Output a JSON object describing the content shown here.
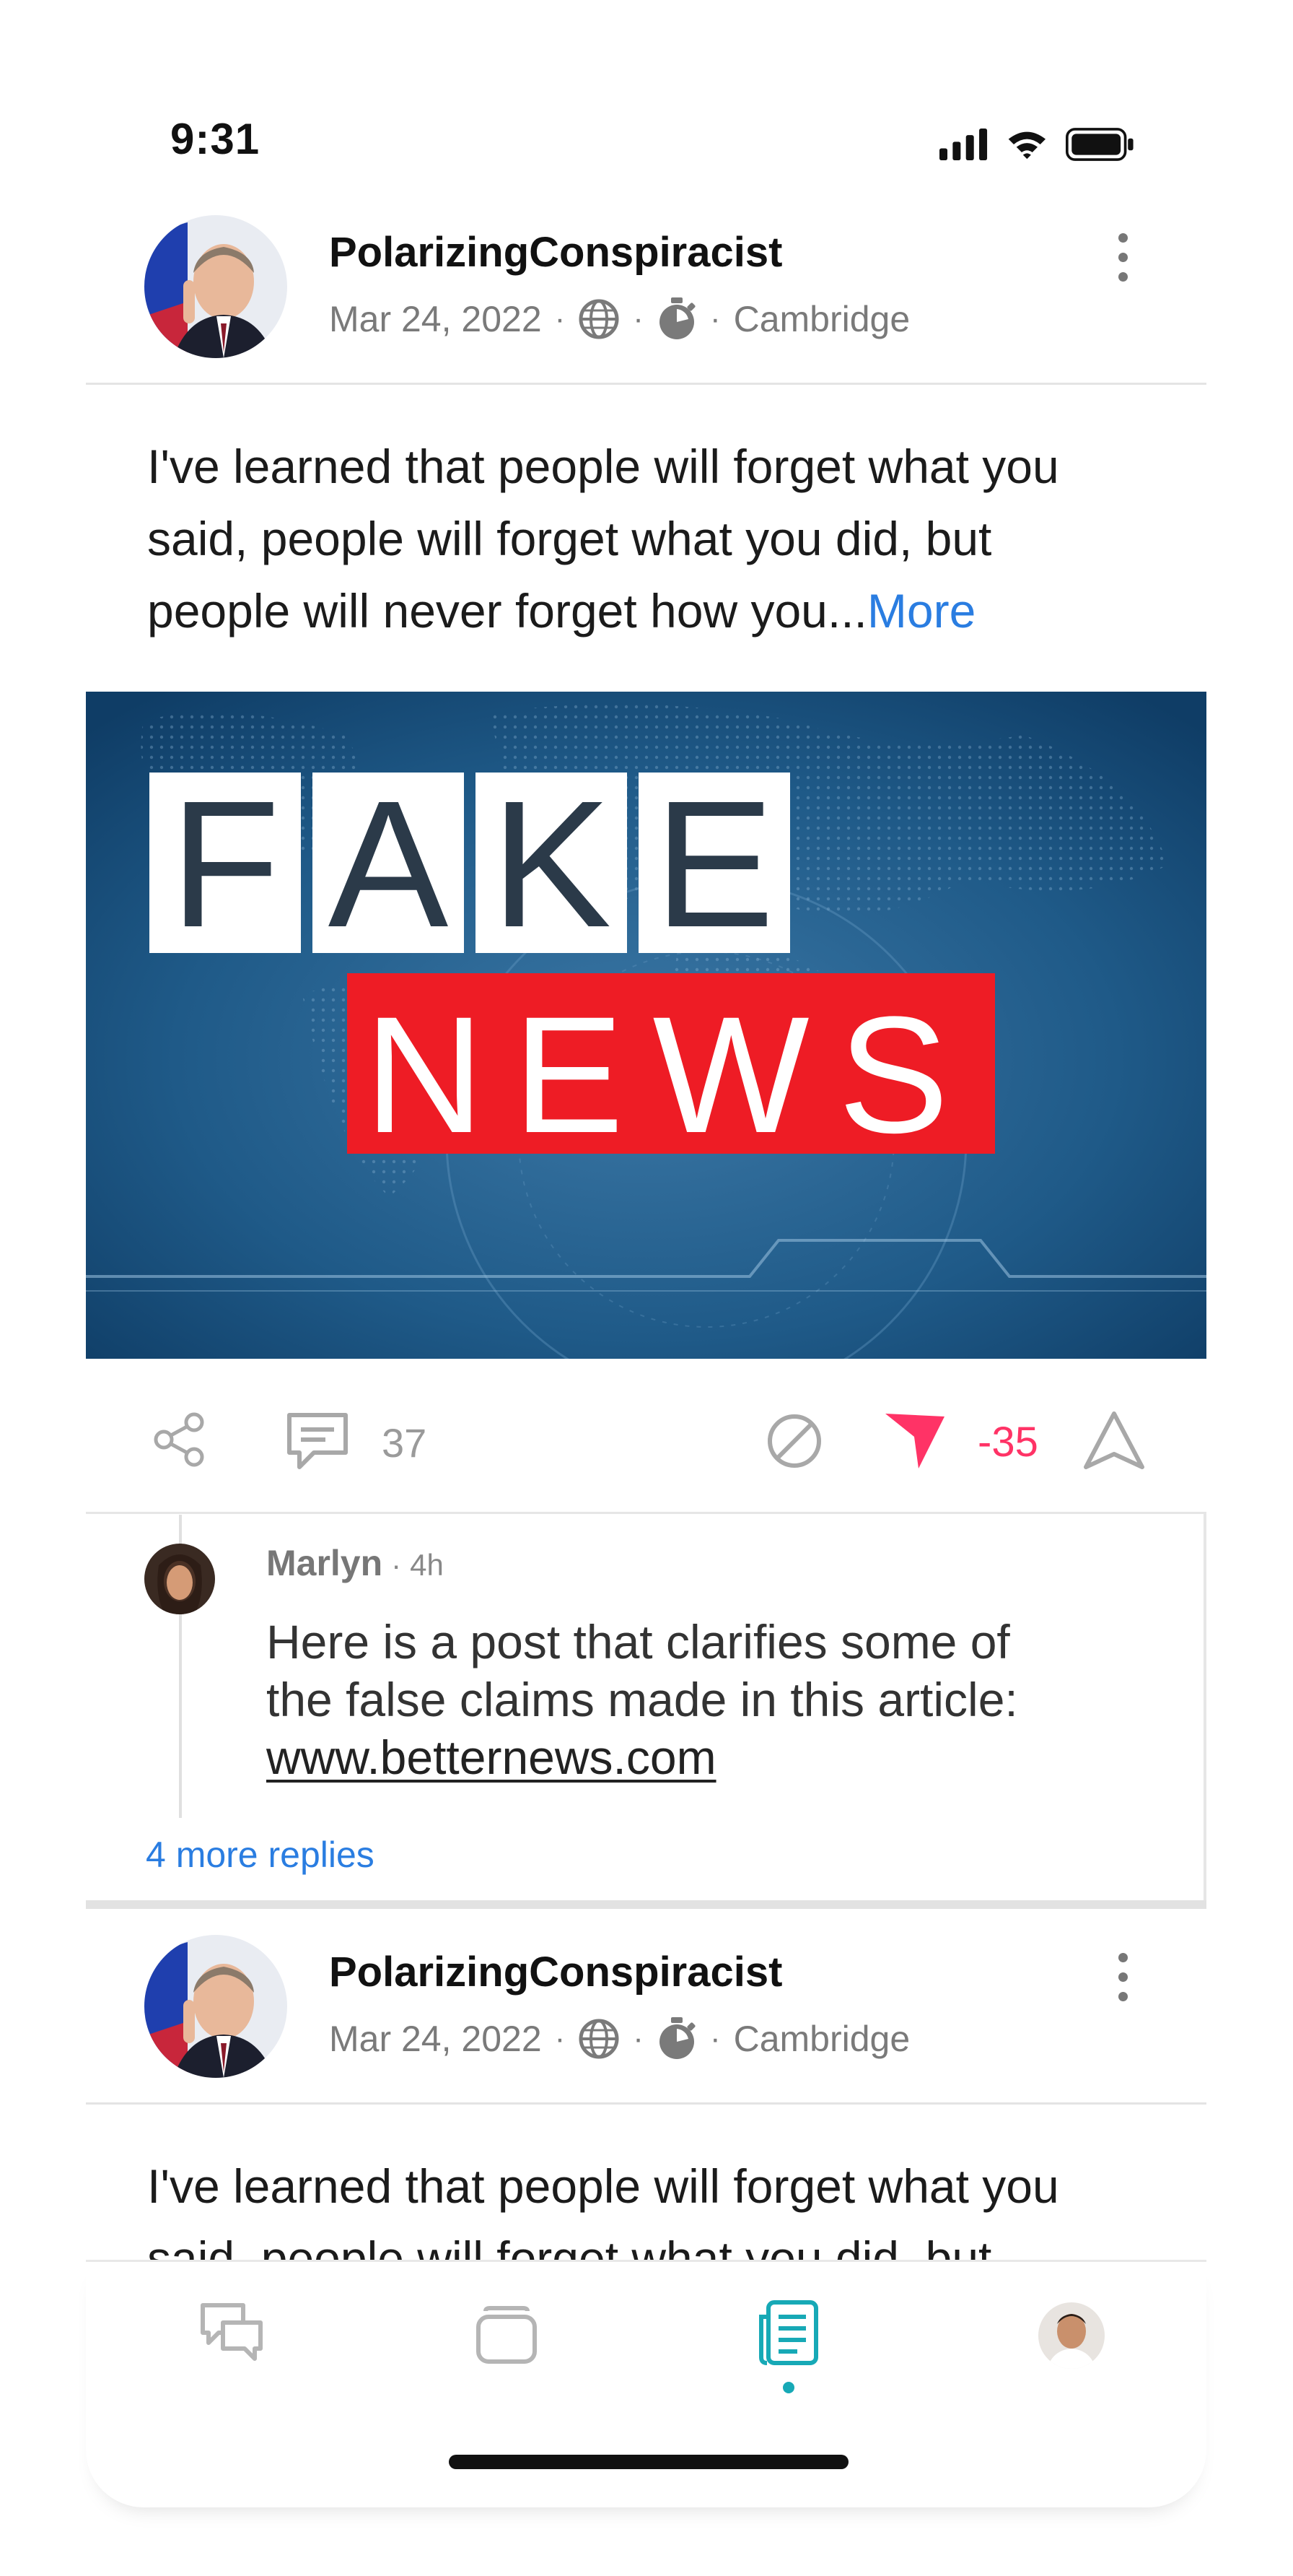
{
  "status_bar": {
    "time": "9:31"
  },
  "posts": [
    {
      "username": "PolarizingConspiracist",
      "date": "Mar 24, 2022",
      "location": "Cambridge",
      "text": "I've learned that people will forget what you said, people will forget what you did, but people will never forget how you...",
      "text_line1": "I've learned that people will forget what you",
      "text_line2": "said, people will forget what you did, but",
      "text_line3": "people will never forget how you...",
      "more_label": "More",
      "image": {
        "headline_top": "FAKE",
        "headline_bottom": "NEWS"
      },
      "comment_count": "37",
      "score": "-35"
    },
    {
      "username": "PolarizingConspiracist",
      "date": "Mar 24, 2022",
      "location": "Cambridge",
      "text_line1": "I've learned that people will forget what you",
      "text_line2": "said, people will forget what you did, but"
    }
  ],
  "comment": {
    "author": "Marlyn",
    "time": "4h",
    "line1": "Here is a post that clarifies some of",
    "line2": "the false claims made in this article:",
    "link": "www.betternews.com",
    "more_replies": "4 more replies"
  },
  "bottom_nav": {
    "items": [
      "chat-icon",
      "cards-icon",
      "feed-icon",
      "profile-avatar"
    ],
    "active": "feed-icon"
  },
  "colors": {
    "accent_blue": "#2a7de1",
    "downvote_pink": "#ff3366",
    "nav_active_teal": "#17a9b6"
  }
}
